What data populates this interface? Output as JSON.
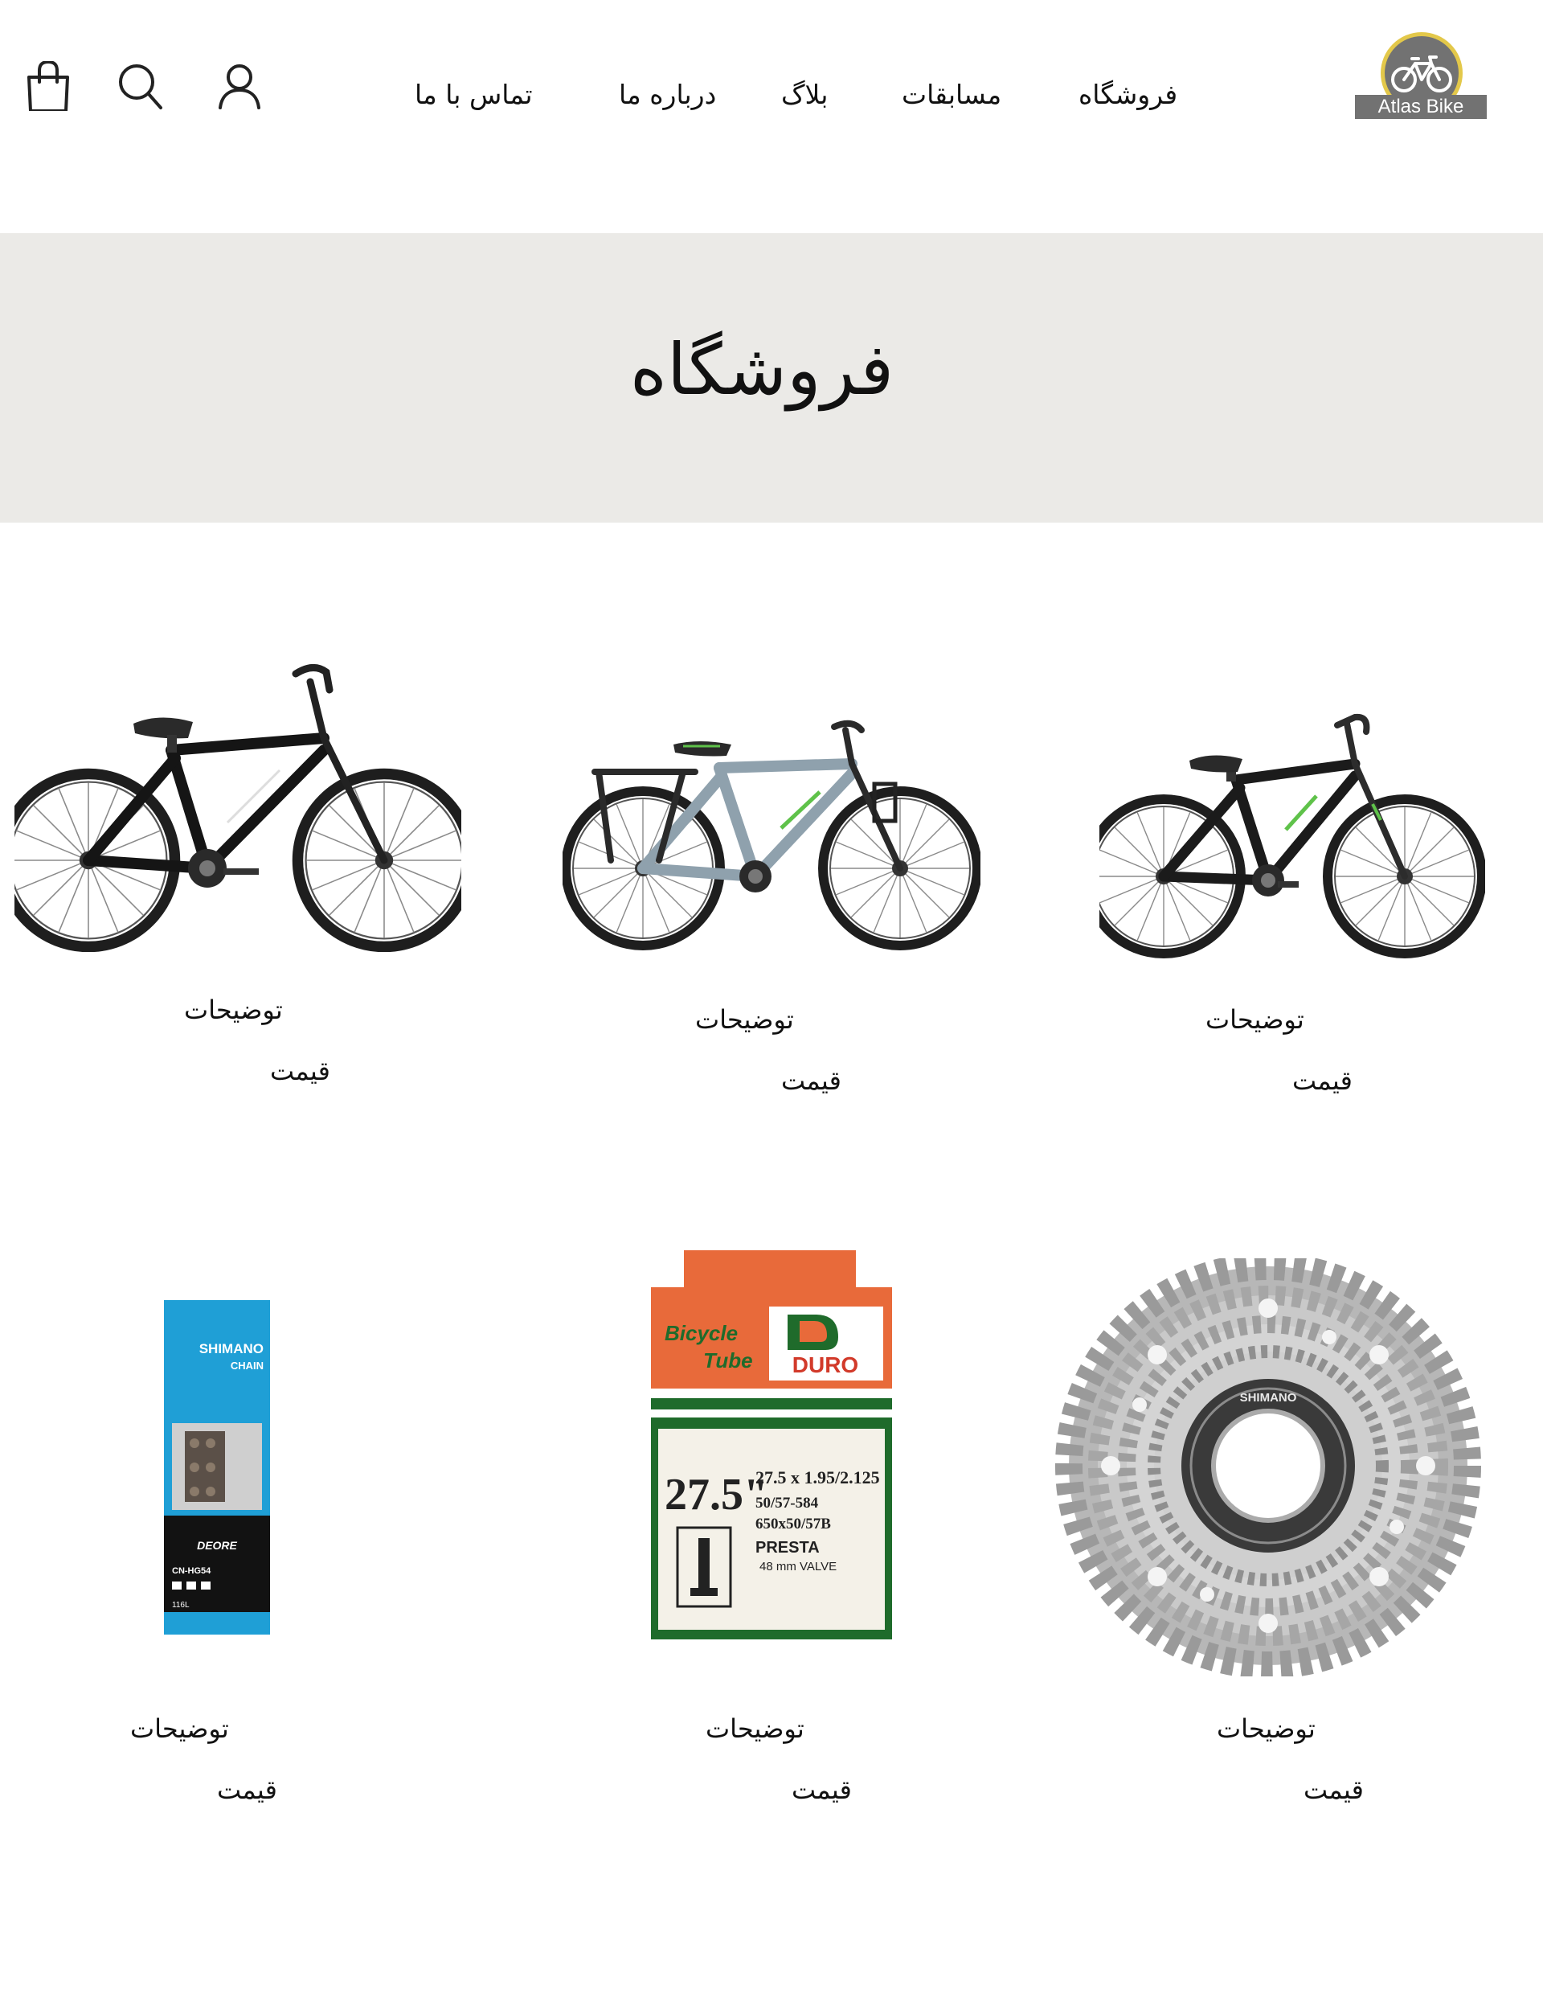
{
  "header": {
    "logo_text": "Atlas Bike",
    "nav": {
      "shop": "فروشگاه",
      "competitions": "مسابقات",
      "blog": "بلاگ",
      "about": "درباره ما",
      "contact": "تماس با ما"
    },
    "icons": [
      "user-icon",
      "search-icon",
      "shopping-bag-icon"
    ]
  },
  "hero": {
    "title": "فروشگاه"
  },
  "products": [
    {
      "image": "black-green-bicycle",
      "description": "توضیحات",
      "price": "قیمت"
    },
    {
      "image": "grey-touring-bicycle",
      "description": "توضیحات",
      "price": "قیمت"
    },
    {
      "image": "black-hybrid-bicycle",
      "description": "توضیحات",
      "price": "قیمت"
    },
    {
      "image": "shimano-cassette",
      "description": "توضیحات",
      "price": "قیمت"
    },
    {
      "image": "duro-bicycle-tube-box",
      "description": "توضیحات",
      "price": "قیمت"
    },
    {
      "image": "shimano-chain-box",
      "description": "توضیحات",
      "price": "قیمت"
    }
  ],
  "product_art": {
    "tube_box": {
      "brand_line_1": "Bicycle",
      "brand_line_2": "Tube",
      "brand": "DURO",
      "size": "27.5\"",
      "spec_1": "27.5 x 1.95/2.125",
      "spec_2": "50/57-584",
      "spec_3": "650x50/57B",
      "valve": "PRESTA",
      "valve_size": "48 mm VALVE"
    },
    "chain_box": {
      "brand": "SHIMANO",
      "type": "CHAIN",
      "series": "DEORE",
      "model": "CN-HG54",
      "length": "116L"
    },
    "cassette": {
      "brand": "SHIMANO"
    }
  },
  "colors": {
    "hero_background": "#ebeae7",
    "logo_gold": "#e3c84a",
    "logo_grey": "#727272",
    "text": "#111111"
  }
}
